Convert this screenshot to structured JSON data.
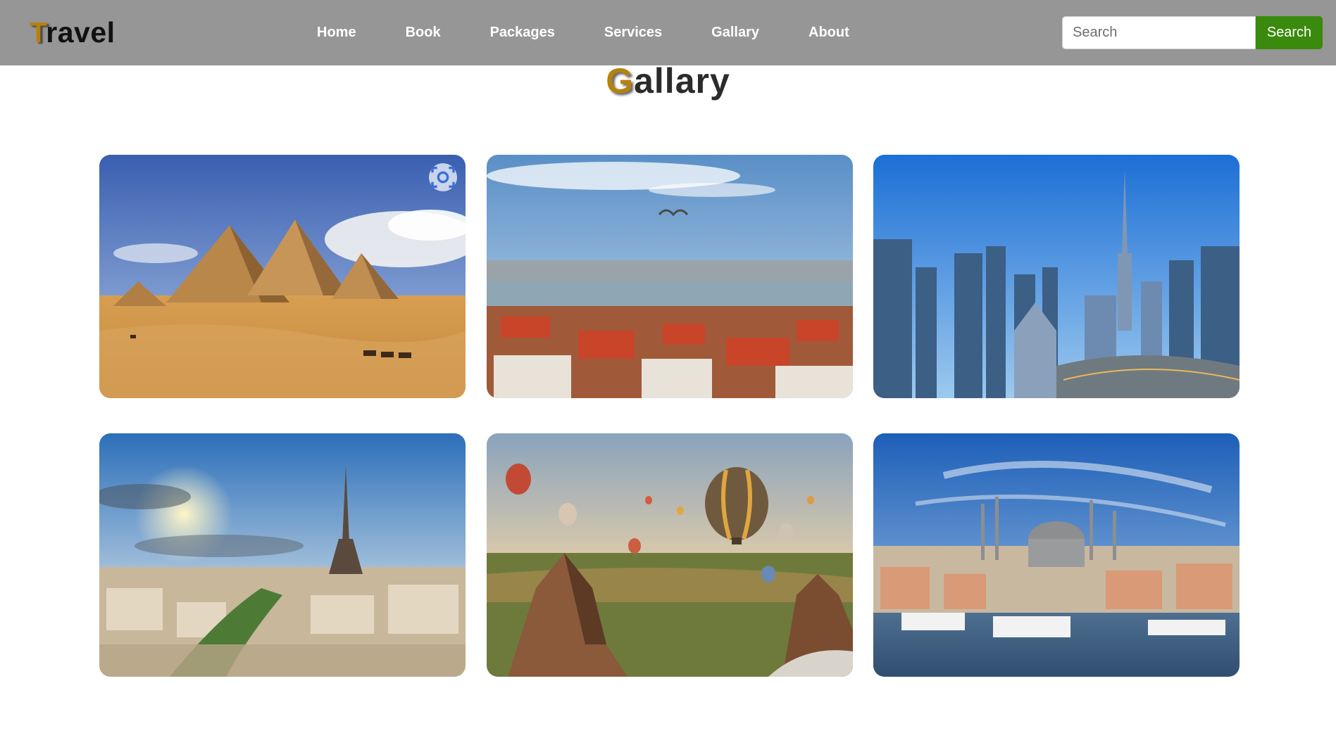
{
  "navbar": {
    "logo_first": "T",
    "logo_rest": "ravel",
    "links": [
      "Home",
      "Book",
      "Packages",
      "Services",
      "Gallary",
      "About"
    ],
    "search": {
      "placeholder": "Search",
      "button_label": "Search"
    }
  },
  "heading": {
    "first": "G",
    "rest": "allary"
  },
  "gallery": [
    {
      "name": "gallery-image-pyramids",
      "subject": "Pyramids of Giza with camels in the desert"
    },
    {
      "name": "gallery-image-istanbul-bridge",
      "subject": "Istanbul rooftops and Golden Horn with a seagull"
    },
    {
      "name": "gallery-image-dubai",
      "subject": "Dubai skyline with Burj Khalifa and highways"
    },
    {
      "name": "gallery-image-paris",
      "subject": "Paris cityscape with Eiffel Tower at sunset"
    },
    {
      "name": "gallery-image-cappadocia",
      "subject": "Hot air balloons over Cappadocia rock formations"
    },
    {
      "name": "gallery-image-istanbul-mosque",
      "subject": "Istanbul waterfront with mosque and ferries"
    }
  ],
  "icons": {
    "image-search": "lens-icon"
  },
  "colors": {
    "navbar": "#969696",
    "accent": "#b5820f",
    "search_button": "#3a8a0d"
  }
}
